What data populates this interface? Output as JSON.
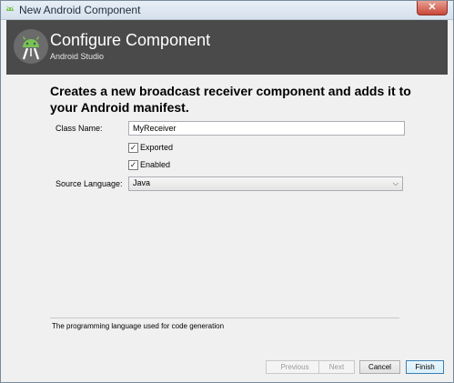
{
  "window": {
    "title": "New Android Component",
    "close_symbol": "✕",
    "icon": "android-studio-icon"
  },
  "banner": {
    "title": "Configure Component",
    "subtitle": "Android Studio",
    "logo": "android-studio-logo",
    "background": "#4a4a4a"
  },
  "form": {
    "heading": "Creates a new broadcast receiver component and adds it to your Android manifest.",
    "class_name_label": "Class Name:",
    "class_name_value": "MyReceiver",
    "exported_label": "Exported",
    "exported_checked": true,
    "enabled_label": "Enabled",
    "enabled_checked": true,
    "source_language_label": "Source Language:",
    "source_language_value": "Java",
    "description": "The programming language used for code generation",
    "check_mark": "✓",
    "dropdown_arrow": "⌵"
  },
  "buttons": {
    "previous": "Previous",
    "next": "Next",
    "cancel": "Cancel",
    "finish": "Finish"
  },
  "colors": {
    "banner": "#4a4a4a",
    "logo_green": "#78c257",
    "focus_border": "#3c7fb1"
  }
}
